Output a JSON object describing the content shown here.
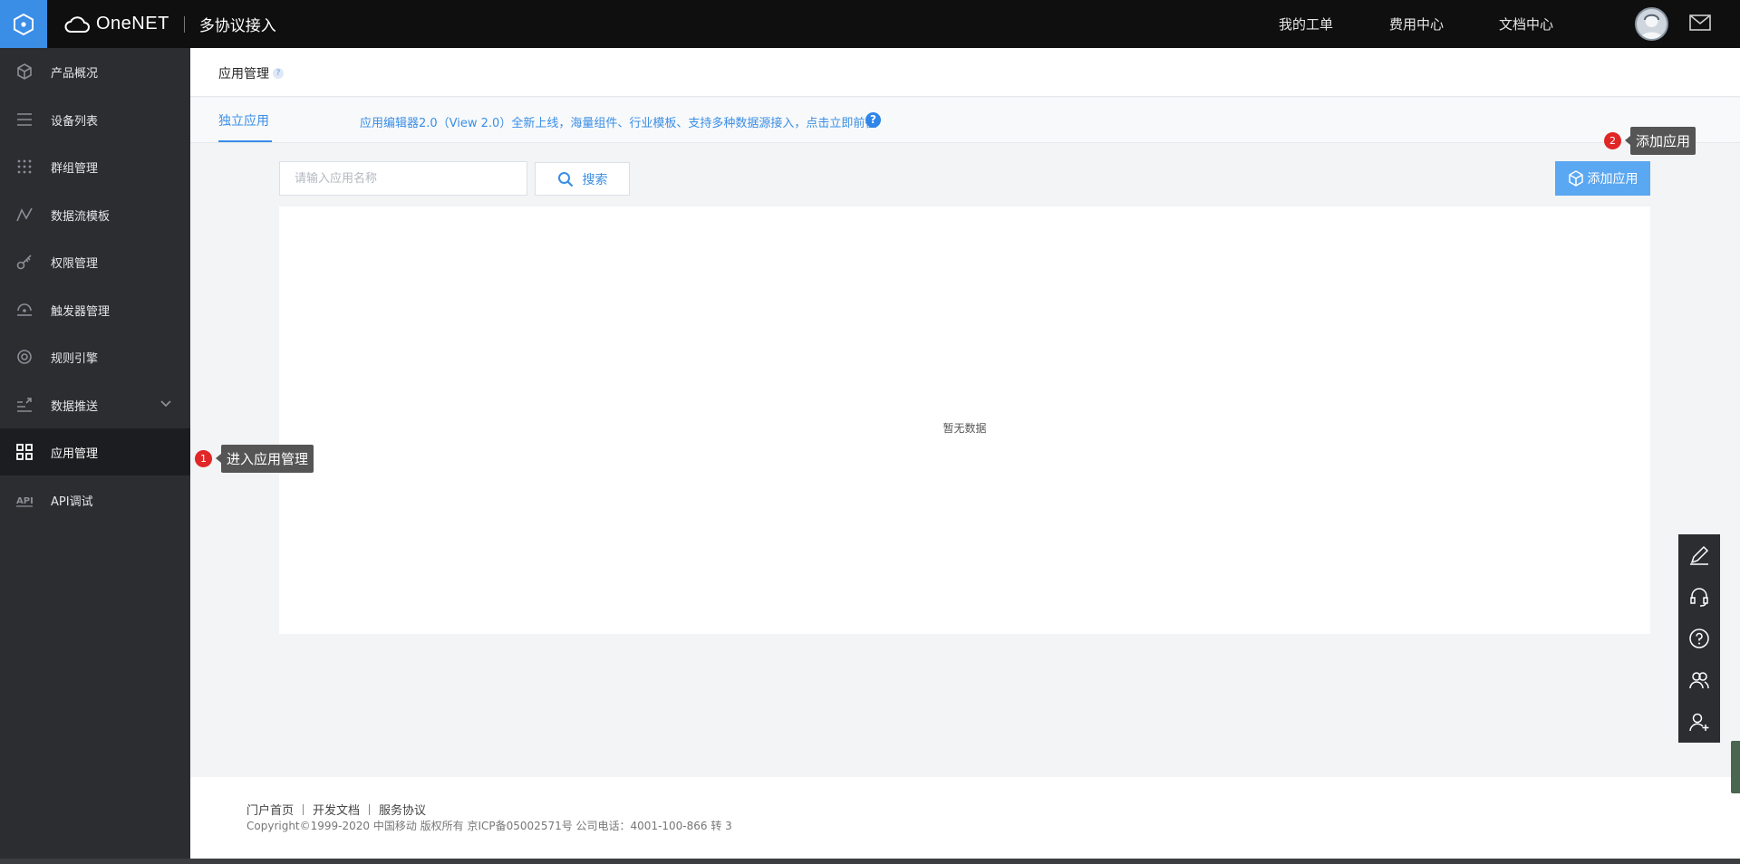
{
  "header": {
    "brand_name": "OneNET",
    "brand_sub": "多协议接入",
    "nav": [
      "我的工单",
      "费用中心",
      "文档中心"
    ]
  },
  "sidebar": {
    "items": [
      {
        "label": "产品概况",
        "icon": "cube-icon"
      },
      {
        "label": "设备列表",
        "icon": "list-icon"
      },
      {
        "label": "群组管理",
        "icon": "grid-dots-icon"
      },
      {
        "label": "数据流模板",
        "icon": "line-chart-icon"
      },
      {
        "label": "权限管理",
        "icon": "key-icon"
      },
      {
        "label": "触发器管理",
        "icon": "trigger-icon"
      },
      {
        "label": "规则引擎",
        "icon": "target-icon"
      },
      {
        "label": "数据推送",
        "icon": "push-icon"
      },
      {
        "label": "应用管理",
        "icon": "apps-icon"
      },
      {
        "label": "API调试",
        "icon": "api-icon"
      }
    ],
    "active": "应用管理"
  },
  "page": {
    "title": "应用管理",
    "help_mark": "?"
  },
  "tabs": {
    "active_label": "独立应用",
    "promo_text": "应用编辑器2.0（View 2.0）全新上线，海量组件、行业模板、支持多种数据源接入，点击立即前往",
    "promo_help": "?"
  },
  "toolbar": {
    "search_placeholder": "请输入应用名称",
    "search_label": "搜索",
    "add_label": "添加应用"
  },
  "table": {
    "empty_text": "暂无数据"
  },
  "tips": [
    {
      "number": "1",
      "text": "进入应用管理"
    },
    {
      "number": "2",
      "text": "添加应用"
    }
  ],
  "footer": {
    "links": [
      "门户首页",
      "开发文档",
      "服务协议"
    ],
    "copyright": "Copyright©1999-2020 中国移动 版权所有 京ICP备05002571号 公司电话：4001-100-866 转 3"
  },
  "colors": {
    "accent": "#3a8ee6",
    "sidebar_bg": "#2b2d31",
    "topbar_bg": "#0f0f0f",
    "tip_bg": "#555555",
    "badge_red": "#e02626"
  },
  "float_tools": [
    "edit-icon",
    "headset-icon",
    "help-circle-icon",
    "users-icon",
    "add-user-icon"
  ]
}
